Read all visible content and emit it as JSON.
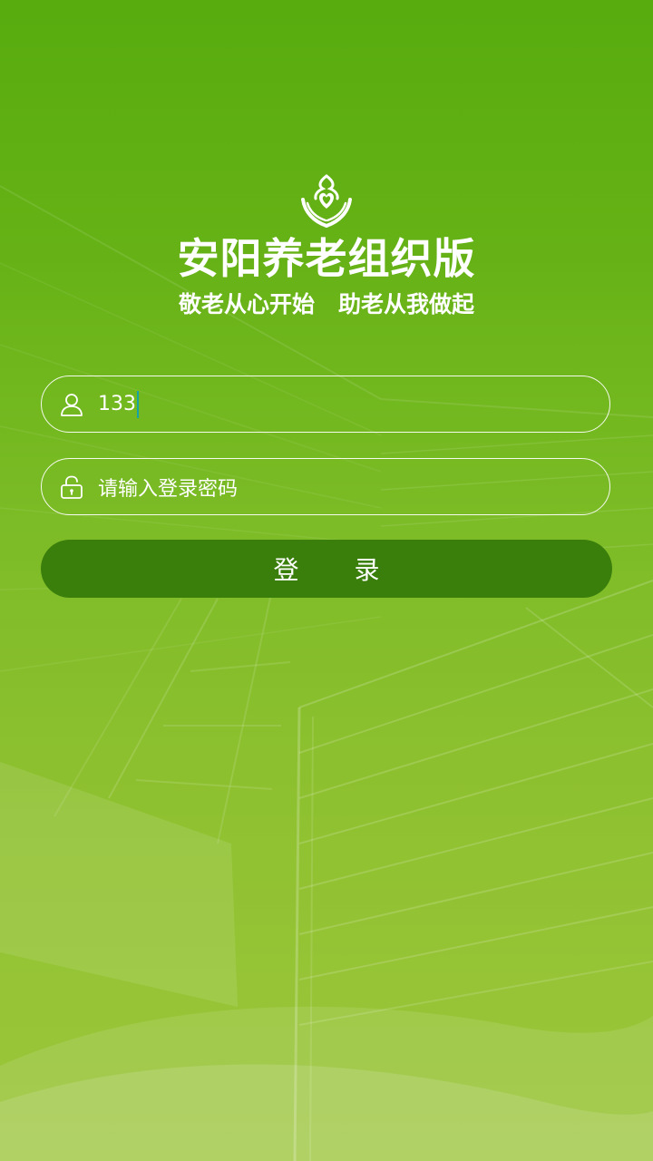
{
  "header": {
    "title": "安阳养老组织版",
    "slogan_left": "敬老从心开始",
    "slogan_right": "助老从我做起"
  },
  "login": {
    "username_value": "133",
    "password_placeholder": "请输入登录密码",
    "submit_label": "登 录"
  },
  "icons": {
    "logo": "heart-hands-logo-icon",
    "username": "user-icon",
    "password": "lock-icon"
  },
  "colors": {
    "background_top": "#58ac0e",
    "background_bottom": "#9cc63c",
    "button": "#3a7f0c",
    "caret": "#17a2a6",
    "text": "#ffffff"
  }
}
